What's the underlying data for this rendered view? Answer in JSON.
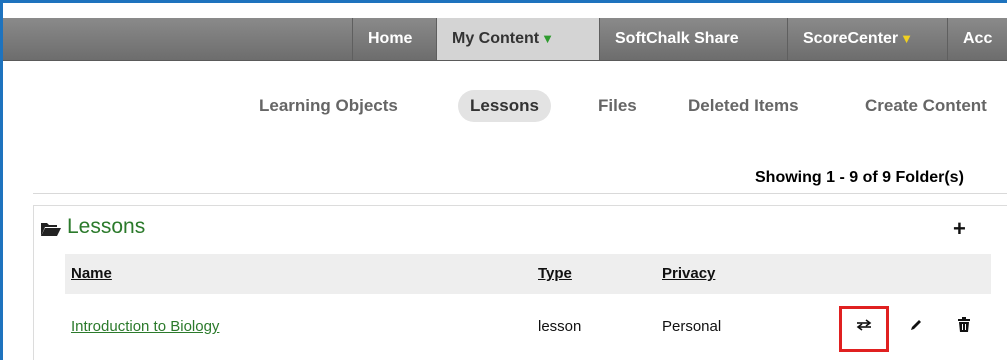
{
  "nav": {
    "items": [
      {
        "label": "Home"
      },
      {
        "label": "My Content",
        "caret": "▼",
        "active": true
      },
      {
        "label": "SoftChalk Share"
      },
      {
        "label": "ScoreCenter",
        "caret": "▼"
      },
      {
        "label": "Acc"
      }
    ]
  },
  "subnav": {
    "items": [
      {
        "label": "Learning Objects"
      },
      {
        "label": "Lessons",
        "active": true
      },
      {
        "label": "Files"
      },
      {
        "label": "Deleted Items"
      },
      {
        "label": "Create Content"
      }
    ]
  },
  "showing_text": "Showing 1 - 9 of 9 Folder(s)",
  "panel": {
    "title": "Lessons",
    "add_label": "+",
    "headers": {
      "name": "Name",
      "type": "Type",
      "privacy": "Privacy"
    },
    "rows": [
      {
        "name": "Introduction to Biology",
        "type": "lesson",
        "privacy": "Personal",
        "actions": [
          "share-arrows-icon",
          "edit-pencil-icon",
          "delete-trash-icon"
        ]
      }
    ]
  },
  "colors": {
    "accent_border": "#1e73be",
    "link_green": "#2b7a2b",
    "highlight_red": "#e02020"
  }
}
